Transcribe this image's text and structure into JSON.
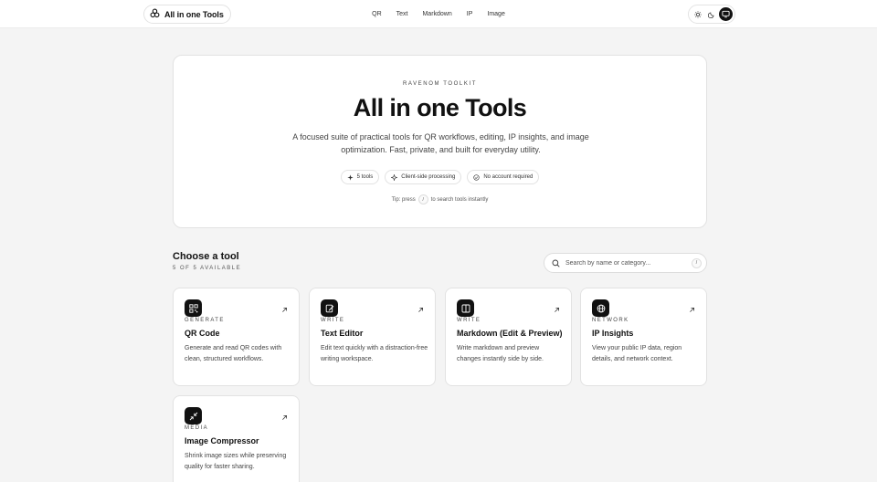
{
  "header": {
    "brand": "All in one Tools",
    "nav": [
      "QR",
      "Text",
      "Markdown",
      "IP",
      "Image"
    ],
    "theme_options": [
      "sun-icon",
      "moon-icon",
      "monitor-icon"
    ],
    "active_theme": "monitor-icon"
  },
  "hero": {
    "eyebrow": "RAVENOM TOOLKIT",
    "title": "All in one Tools",
    "subtitle": "A focused suite of practical tools for QR workflows, editing, IP insights, and image optimization. Fast, private, and built for everyday utility.",
    "pills": [
      {
        "icon": "sparkle-icon",
        "label": "5 tools"
      },
      {
        "icon": "sparkle-icon",
        "label": "Client-side processing"
      },
      {
        "icon": "check-circle-icon",
        "label": "No account required"
      }
    ],
    "tip_before": "Tip: press",
    "tip_key": "/",
    "tip_after": "to search tools instantly"
  },
  "tools_section": {
    "title": "Choose a tool",
    "count": "5 OF 5 AVAILABLE",
    "search_placeholder": "Search by name or category...",
    "search_key": "/"
  },
  "cards": [
    {
      "icon": "qr-icon",
      "category": "GENERATE",
      "title": "QR Code",
      "description": "Generate and read QR codes with clean, structured workflows."
    },
    {
      "icon": "edit-icon",
      "category": "WRITE",
      "title": "Text Editor",
      "description": "Edit text quickly with a distraction-free writing workspace."
    },
    {
      "icon": "split-view-icon",
      "category": "WRITE",
      "title": "Markdown (Edit & Preview)",
      "description": "Write markdown and preview changes instantly side by side."
    },
    {
      "icon": "globe-icon",
      "category": "NETWORK",
      "title": "IP Insights",
      "description": "View your public IP data, region details, and network context."
    },
    {
      "icon": "compress-icon",
      "category": "MEDIA",
      "title": "Image Compressor",
      "description": "Shrink image sizes while preserving quality for faster sharing."
    }
  ],
  "colors": {
    "accent": "#111111",
    "background": "#f4f4f4",
    "card": "#ffffff",
    "border": "#e2e2e2"
  }
}
